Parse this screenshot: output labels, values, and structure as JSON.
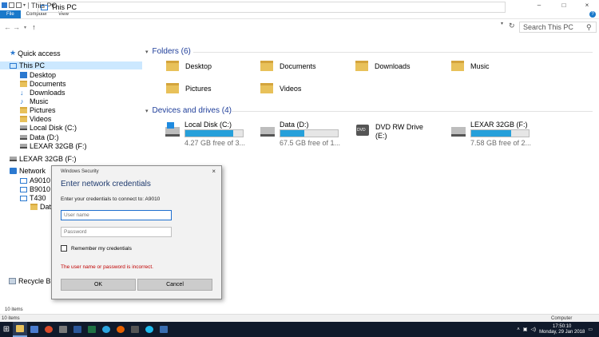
{
  "window": {
    "title": "This PC",
    "controls": [
      "–",
      "□",
      "×"
    ]
  },
  "ribbon": {
    "tabs": [
      "File",
      "Computer",
      "View"
    ],
    "help": "?"
  },
  "address": {
    "path": "This PC",
    "search_placeholder": "Search This PC"
  },
  "nav": {
    "quick_access": "Quick access",
    "this_pc": "This PC",
    "this_pc_children": [
      "Desktop",
      "Documents",
      "Downloads",
      "Music",
      "Pictures",
      "Videos",
      "Local Disk (C:)",
      "Data (D:)",
      "LEXAR 32GB (F:)"
    ],
    "lexar": "LEXAR 32GB (F:)",
    "network": "Network",
    "network_children": [
      "A9010",
      "B9010",
      "T430"
    ],
    "t430_child": "Data",
    "recycle": "Recycle Bin"
  },
  "content": {
    "folders_header": "Folders (6)",
    "folders": [
      "Desktop",
      "Documents",
      "Downloads",
      "Music",
      "Pictures",
      "Videos"
    ],
    "drives_header": "Devices and drives (4)",
    "drives": [
      {
        "name": "Local Disk (C:)",
        "free": "4.27 GB free of 3...",
        "used_fraction": 0.83
      },
      {
        "name": "Data (D:)",
        "free": "67.5 GB free of 1...",
        "used_fraction": 0.42
      },
      {
        "name": "DVD RW Drive",
        "name2": "(E:)"
      },
      {
        "name": "LEXAR 32GB (F:)",
        "free": "7.58 GB free of 2...",
        "used_fraction": 0.7
      }
    ]
  },
  "status": {
    "items": "10 items",
    "selected": "10 items",
    "computer": "Computer"
  },
  "taskbar": {
    "time": "17:50:10",
    "date": "Monday, 29 Jan 2018"
  },
  "dialog": {
    "title": "Windows Security",
    "close": "×",
    "heading": "Enter network credentials",
    "subtitle": "Enter your credentials to connect to: A9010",
    "username_placeholder": "User name",
    "password_placeholder": "Password",
    "remember_label": "Remember my credentials",
    "error": "The user name or password is incorrect.",
    "ok_label": "OK",
    "cancel_label": "Cancel"
  },
  "colors": {
    "accent": "#1979ca",
    "header_text": "#1f3e9a",
    "error": "#c00000",
    "drive_fill": "#26a0da"
  }
}
